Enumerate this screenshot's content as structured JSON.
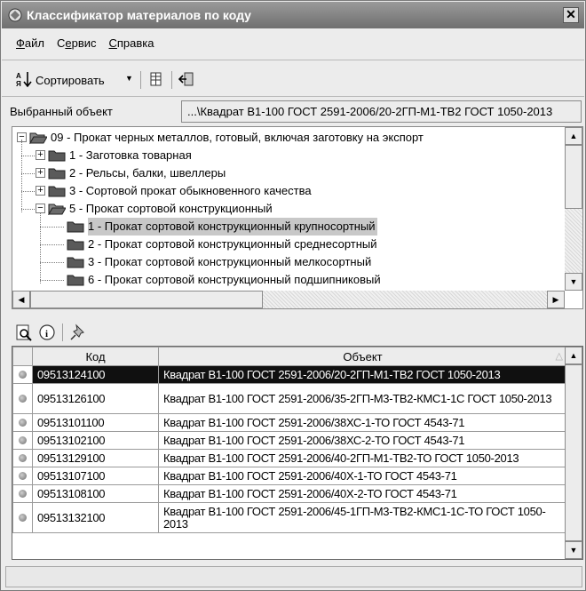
{
  "window": {
    "title": "Классификатор материалов по коду",
    "close_symbol": "✕"
  },
  "menu": [
    {
      "prefix": "",
      "accel": "Ф",
      "rest": "айл"
    },
    {
      "prefix": "С",
      "accel": "е",
      "rest": "рвис"
    },
    {
      "prefix": "",
      "accel": "С",
      "rest": "правка"
    }
  ],
  "toolbar": {
    "sort_label": "Сортировать",
    "sort_icon": "sort-az-icon",
    "filter_icon": "columns-icon",
    "exit_icon": "exit-icon"
  },
  "selected_object": {
    "label": "Выбранный объект",
    "value": "...\\Квадрат В1-100 ГОСТ 2591-2006/20-2ГП-М1-ТВ2 ГОСТ 1050-2013"
  },
  "tree": {
    "nodes": [
      {
        "text": "09 - Прокат черных металлов, готовый, включая заготовку на экспорт",
        "level": 0,
        "expander": "−",
        "open": true,
        "selected": false
      },
      {
        "text": "1 - Заготовка товарная",
        "level": 1,
        "expander": "+",
        "open": false,
        "selected": false
      },
      {
        "text": "2 - Рельсы, балки, швеллеры",
        "level": 1,
        "expander": "+",
        "open": false,
        "selected": false
      },
      {
        "text": "3 - Сортовой прокат обыкновенного качества",
        "level": 1,
        "expander": "+",
        "open": false,
        "selected": false
      },
      {
        "text": "5 - Прокат сортовой конструкционный",
        "level": 1,
        "expander": "−",
        "open": true,
        "selected": false
      },
      {
        "text": "1 - Прокат сортовой конструкционный крупносортный",
        "level": 2,
        "expander": "",
        "open": false,
        "selected": true
      },
      {
        "text": "2 - Прокат сортовой конструкционный среднесортный",
        "level": 2,
        "expander": "",
        "open": false,
        "selected": false
      },
      {
        "text": "3 - Прокат сортовой конструкционный мелкосортный",
        "level": 2,
        "expander": "",
        "open": false,
        "selected": false
      },
      {
        "text": "6 - Прокат сортовой конструкционный подшипниковый",
        "level": 2,
        "expander": "",
        "open": false,
        "selected": false
      }
    ]
  },
  "grid": {
    "toolbar_icons": [
      "preview-icon",
      "info-icon",
      "pin-icon"
    ],
    "columns": {
      "code": "Код",
      "object": "Объект",
      "sort_marker": "△"
    },
    "rows": [
      {
        "code": "09513124100",
        "object": "Квадрат В1-100 ГОСТ 2591-2006/20-2ГП-М1-ТВ2 ГОСТ 1050-2013",
        "active": true
      },
      {
        "code": "09513126100",
        "object": "Квадрат В1-100 ГОСТ 2591-2006/35-2ГП-М3-ТВ2-КМС1-1С ГОСТ 1050-2013",
        "active": false
      },
      {
        "code": "09513101100",
        "object": "Квадрат В1-100 ГОСТ 2591-2006/38ХС-1-ТО ГОСТ 4543-71",
        "active": false
      },
      {
        "code": "09513102100",
        "object": "Квадрат В1-100 ГОСТ 2591-2006/38ХС-2-ТО ГОСТ 4543-71",
        "active": false
      },
      {
        "code": "09513129100",
        "object": "Квадрат В1-100 ГОСТ 2591-2006/40-2ГП-М1-ТВ2-ТО ГОСТ 1050-2013",
        "active": false
      },
      {
        "code": "09513107100",
        "object": "Квадрат В1-100 ГОСТ 2591-2006/40Х-1-ТО ГОСТ 4543-71",
        "active": false
      },
      {
        "code": "09513108100",
        "object": "Квадрат В1-100 ГОСТ 2591-2006/40Х-2-ТО ГОСТ 4543-71",
        "active": false
      },
      {
        "code": "09513132100",
        "object": "Квадрат В1-100 ГОСТ 2591-2006/45-1ГП-М3-ТВ2-КМС1-1С-ТО ГОСТ 1050-2013",
        "active": false
      }
    ]
  },
  "statusbar": {
    "text": ""
  }
}
